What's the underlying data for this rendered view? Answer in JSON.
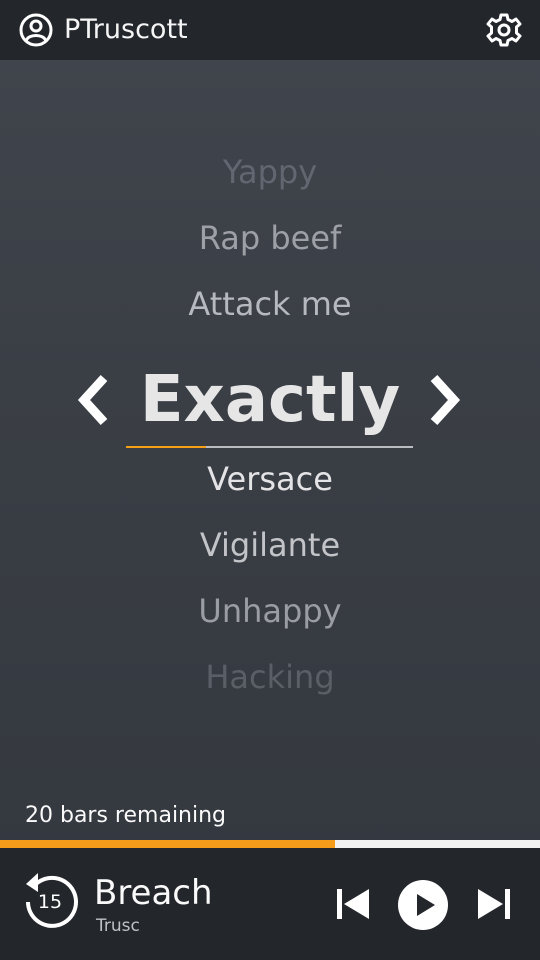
{
  "header": {
    "username": "PTruscott",
    "user_icon": "account-circle-icon",
    "settings_icon": "gear-icon"
  },
  "word_list": {
    "previous": [
      "Yappy",
      "Rap beef",
      "Attack me"
    ],
    "current": "Exactly",
    "next": [
      "Versace",
      "Vigilante",
      "Unhappy",
      "Hacking"
    ],
    "current_word_progress": 0.28
  },
  "status": {
    "bars_remaining": "20 bars remaining",
    "progress": 0.62
  },
  "player": {
    "replay_seconds": "15",
    "track_title": "Breach",
    "artist": "Trusc",
    "icons": {
      "replay": "replay-15-icon",
      "previous": "skip-previous-icon",
      "play": "play-icon",
      "next": "skip-next-icon"
    }
  },
  "colors": {
    "accent": "#f59c1a",
    "bar_bg": "#23262b",
    "background": "#3a3e45"
  }
}
